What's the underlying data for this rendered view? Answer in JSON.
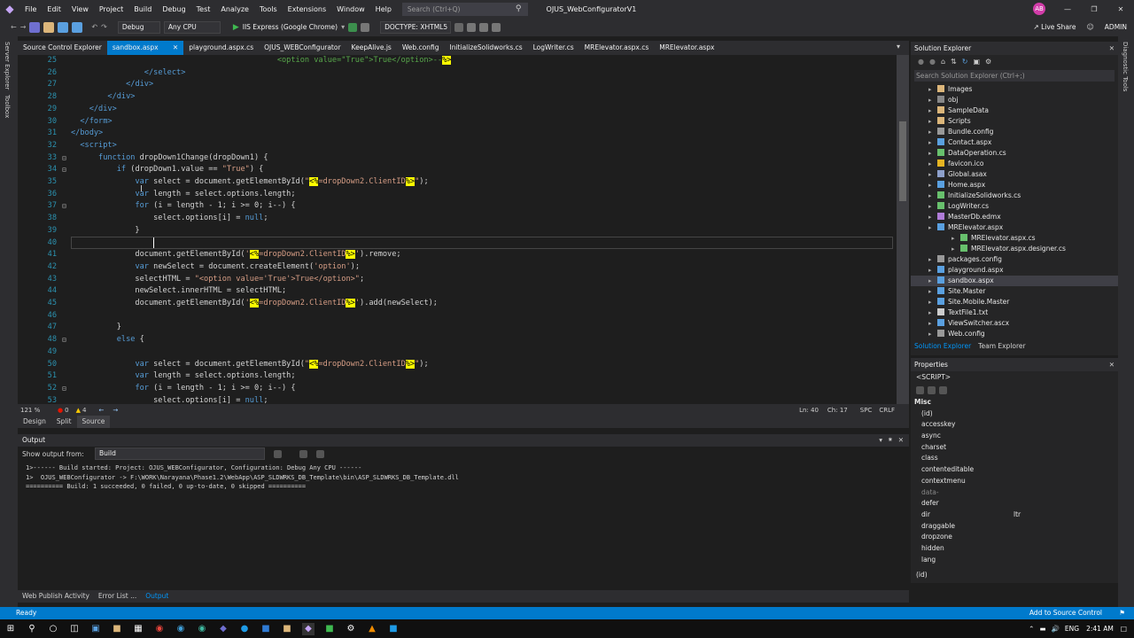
{
  "title_bar": {
    "menu": [
      "File",
      "Edit",
      "View",
      "Project",
      "Build",
      "Debug",
      "Test",
      "Analyze",
      "Tools",
      "Extensions",
      "Window",
      "Help"
    ],
    "search_placeholder": "Search (Ctrl+Q)",
    "solution_title": "OJUS_WebConfiguratorV1",
    "avatar_initials": "AB",
    "live_share": "Live Share",
    "admin": "ADMIN"
  },
  "toolbar": {
    "config": "Debug",
    "platform": "Any CPU",
    "run_target": "IIS Express (Google Chrome)",
    "doctype": "DOCTYPE: XHTML5"
  },
  "left_rail": [
    "Server Explorer",
    "Toolbox"
  ],
  "tabs": [
    {
      "label": "Source Control Explorer",
      "active": false
    },
    {
      "label": "sandbox.aspx",
      "active": true
    },
    {
      "label": "playground.aspx.cs",
      "active": false
    },
    {
      "label": "OJUS_WEBConfigurator",
      "active": false
    },
    {
      "label": "KeepAlive.js",
      "active": false
    },
    {
      "label": "Web.config",
      "active": false
    },
    {
      "label": "InitializeSolidworks.cs",
      "active": false
    },
    {
      "label": "LogWriter.cs",
      "active": false
    },
    {
      "label": "MRElevator.aspx.cs",
      "active": false
    },
    {
      "label": "MRElevator.aspx",
      "active": false
    }
  ],
  "code_lines": [
    {
      "n": "25",
      "html": "                                             <span class=\"cmt\">&lt;option value=\"True\"&gt;True&lt;/option&gt;--</span><span class=\"hl\">%&gt;</span>"
    },
    {
      "n": "26",
      "html": "                <span class=\"tag\">&lt;/select&gt;</span>"
    },
    {
      "n": "27",
      "html": "            <span class=\"tag\">&lt;/div&gt;</span>"
    },
    {
      "n": "28",
      "html": "        <span class=\"tag\">&lt;/div&gt;</span>"
    },
    {
      "n": "29",
      "html": "    <span class=\"tag\">&lt;/div&gt;</span>"
    },
    {
      "n": "30",
      "html": "  <span class=\"tag\">&lt;/form&gt;</span>"
    },
    {
      "n": "31",
      "html": "<span class=\"tag\">&lt;/body&gt;</span>"
    },
    {
      "n": "32",
      "html": "  <span class=\"tag\">&lt;script&gt;</span>"
    },
    {
      "n": "33",
      "html": "      <span class=\"kw\">function</span> dropDown1Change(dropDown1) {"
    },
    {
      "n": "34",
      "html": "          <span class=\"kw\">if</span> (dropDown1.value == <span class=\"str\">\"True\"</span>) {"
    },
    {
      "n": "35",
      "html": "              <span class=\"kw\">var</span> select = document.getElementById(<span class=\"str\">\"</span><span class=\"hl\">&lt;%</span><span class=\"str\">=dropDown2.ClientID</span><span class=\"hl\">%&gt;</span><span class=\"str\">\"</span>);"
    },
    {
      "n": "36",
      "html": "              <span class=\"kw\">var</span> length = select.options.length;"
    },
    {
      "n": "37",
      "html": "              <span class=\"kw\">for</span> (i = length - 1; i &gt;= 0; i--) {"
    },
    {
      "n": "38",
      "html": "                  select.options[i] = <span class=\"kw\">null</span>;"
    },
    {
      "n": "39",
      "html": "              }"
    },
    {
      "n": "40",
      "html": "              "
    },
    {
      "n": "41",
      "html": "              document.getElementById(<span class=\"str\">'</span><span class=\"hl\">&lt;%</span><span class=\"str\">=dropDown2.ClientID</span><span class=\"hl\">%&gt;</span><span class=\"str\">'</span>).remove;"
    },
    {
      "n": "42",
      "html": "              <span class=\"kw\">var</span> newSelect = document.createElement(<span class=\"str\">'option'</span>);"
    },
    {
      "n": "43",
      "html": "              selectHTML = <span class=\"str\">\"&lt;option value='True'&gt;True&lt;/option&gt;\"</span>;"
    },
    {
      "n": "44",
      "html": "              newSelect.innerHTML = selectHTML;"
    },
    {
      "n": "45",
      "html": "              document.getElementById(<span class=\"str\">'</span><span class=\"hl\">&lt;%</span><span class=\"str\">=dropDown2.ClientID</span><span class=\"hl\">%&gt;</span><span class=\"str\">'</span>).add(newSelect);"
    },
    {
      "n": "46",
      "html": ""
    },
    {
      "n": "47",
      "html": "          }"
    },
    {
      "n": "48",
      "html": "          <span class=\"kw\">else</span> {"
    },
    {
      "n": "49",
      "html": ""
    },
    {
      "n": "50",
      "html": "              <span class=\"kw\">var</span> select = document.getElementById(<span class=\"str\">\"</span><span class=\"hl\">&lt;%</span><span class=\"str\">=dropDown2.ClientID</span><span class=\"hl\">%&gt;</span><span class=\"str\">\"</span>);"
    },
    {
      "n": "51",
      "html": "              <span class=\"kw\">var</span> length = select.options.length;"
    },
    {
      "n": "52",
      "html": "              <span class=\"kw\">for</span> (i = length - 1; i &gt;= 0; i--) {"
    },
    {
      "n": "53",
      "html": "                  select.options[i] = <span class=\"kw\">null</span>;"
    }
  ],
  "editor_status": {
    "zoom": "121 %",
    "errors": "0",
    "warnings": "4",
    "line": "Ln: 40",
    "col": "Ch: 17",
    "mode": "SPC",
    "eol": "CRLF"
  },
  "design_tabs": [
    "Design",
    "Split",
    "Source"
  ],
  "output": {
    "title": "Output",
    "show_from_label": "Show output from:",
    "show_from_value": "Build",
    "lines": [
      "1>------ Build started: Project: OJUS_WEBConfigurator, Configuration: Debug Any CPU ------",
      "1>  OJUS_WEBConfigurator -> F:\\WORK\\Narayana\\Phase1.2\\WebApp\\ASP_SLDWRKS_DB_Template\\bin\\ASP_SLDWRKS_DB_Template.dll",
      "========== Build: 1 succeeded, 0 failed, 0 up-to-date, 0 skipped =========="
    ]
  },
  "bottom_tabs": [
    "Web Publish Activity",
    "Error List ...",
    "Output"
  ],
  "solution_explorer": {
    "title": "Solution Explorer",
    "search_placeholder": "Search Solution Explorer (Ctrl+;)",
    "items": [
      {
        "label": "Images",
        "type": "folder",
        "indent": 1
      },
      {
        "label": "obj",
        "type": "folder-gray",
        "indent": 1
      },
      {
        "label": "SampleData",
        "type": "folder",
        "indent": 1
      },
      {
        "label": "Scripts",
        "type": "folder",
        "indent": 1
      },
      {
        "label": "Bundle.config",
        "type": "config",
        "indent": 1
      },
      {
        "label": "Contact.aspx",
        "type": "aspx",
        "indent": 1
      },
      {
        "label": "DataOperation.cs",
        "type": "cs",
        "indent": 1
      },
      {
        "label": "favicon.ico",
        "type": "ico",
        "indent": 1
      },
      {
        "label": "Global.asax",
        "type": "asax",
        "indent": 1
      },
      {
        "label": "Home.aspx",
        "type": "aspx",
        "indent": 1
      },
      {
        "label": "InitializeSolidworks.cs",
        "type": "cs",
        "indent": 1
      },
      {
        "label": "LogWriter.cs",
        "type": "cs",
        "indent": 1
      },
      {
        "label": "MasterDb.edmx",
        "type": "edmx",
        "indent": 1
      },
      {
        "label": "MRElevator.aspx",
        "type": "aspx",
        "indent": 1
      },
      {
        "label": "MRElevator.aspx.cs",
        "type": "cs",
        "indent": 2
      },
      {
        "label": "MRElevator.aspx.designer.cs",
        "type": "cs",
        "indent": 2
      },
      {
        "label": "packages.config",
        "type": "config",
        "indent": 1
      },
      {
        "label": "playground.aspx",
        "type": "aspx",
        "indent": 1
      },
      {
        "label": "sandbox.aspx",
        "type": "aspx",
        "indent": 1,
        "selected": true
      },
      {
        "label": "Site.Master",
        "type": "master",
        "indent": 1
      },
      {
        "label": "Site.Mobile.Master",
        "type": "master",
        "indent": 1
      },
      {
        "label": "TextFile1.txt",
        "type": "txt",
        "indent": 1
      },
      {
        "label": "ViewSwitcher.ascx",
        "type": "aspx",
        "indent": 1
      },
      {
        "label": "Web.config",
        "type": "config",
        "indent": 1
      }
    ],
    "tabs": [
      "Solution Explorer",
      "Team Explorer"
    ]
  },
  "properties": {
    "title": "Properties",
    "object": "<SCRIPT>",
    "category": "Misc",
    "rows": [
      {
        "name": "(id)",
        "value": ""
      },
      {
        "name": "accesskey",
        "value": ""
      },
      {
        "name": "async",
        "value": ""
      },
      {
        "name": "charset",
        "value": ""
      },
      {
        "name": "class",
        "value": ""
      },
      {
        "name": "contenteditable",
        "value": ""
      },
      {
        "name": "contextmenu",
        "value": ""
      },
      {
        "name": "data-",
        "value": ""
      },
      {
        "name": "defer",
        "value": ""
      },
      {
        "name": "dir",
        "value": "ltr"
      },
      {
        "name": "draggable",
        "value": ""
      },
      {
        "name": "dropzone",
        "value": ""
      },
      {
        "name": "hidden",
        "value": ""
      },
      {
        "name": "lang",
        "value": ""
      }
    ],
    "description": "(id)"
  },
  "right_rail": [
    "Diagnostic Tools"
  ],
  "status_bar": {
    "left": "Ready",
    "right": "Add to Source Control"
  },
  "taskbar": {
    "time": "2:41 AM",
    "lang": "ENG"
  },
  "colors": {
    "accent": "#007acc",
    "editor_bg": "#1e1e1e",
    "chrome": "#2d2d30"
  }
}
